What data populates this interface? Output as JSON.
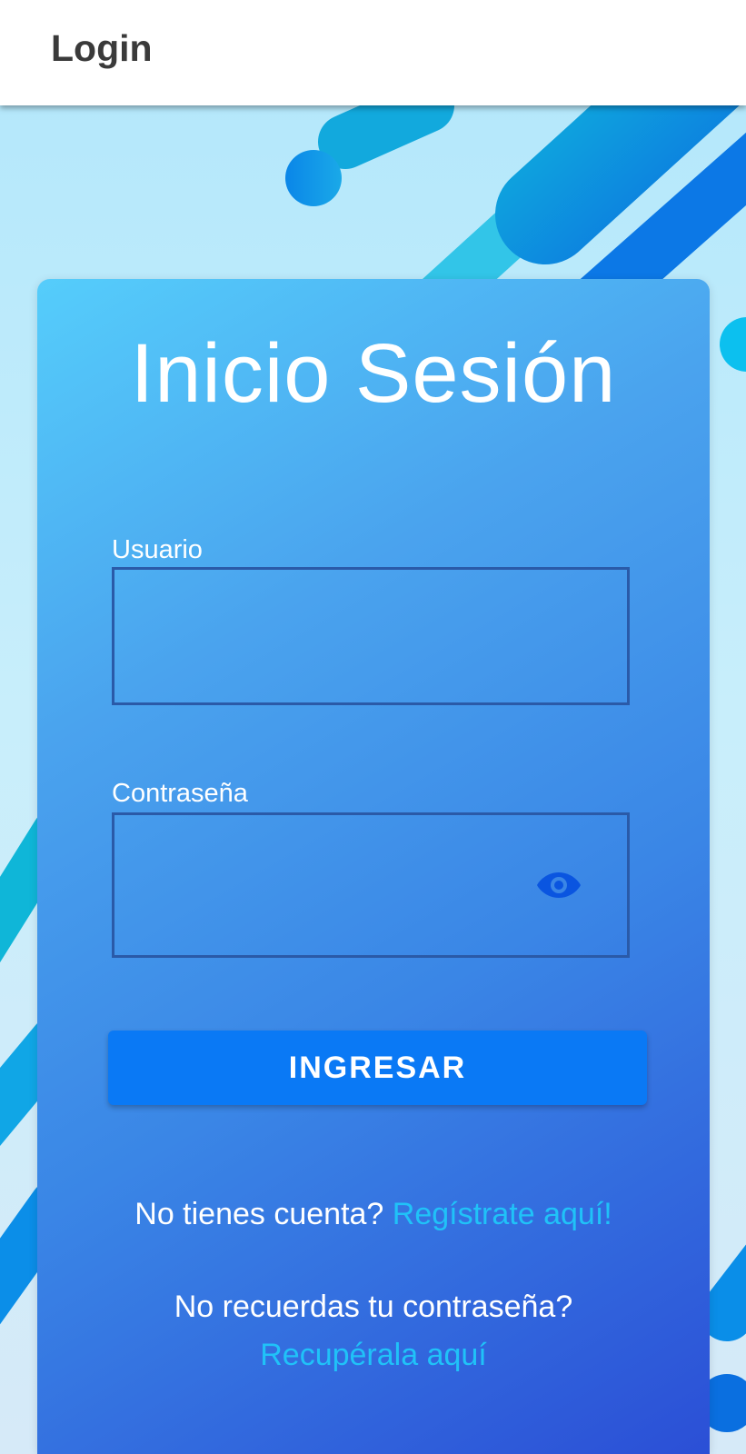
{
  "appbar": {
    "title": "Login"
  },
  "card": {
    "title": "Inicio Sesión",
    "username": {
      "label": "Usuario",
      "value": ""
    },
    "password": {
      "label": "Contraseña",
      "value": "",
      "toggle_icon": "eye-icon"
    },
    "submit_label": "INGRESAR",
    "register": {
      "text": "No tienes cuenta?",
      "link": "Regístrate aquí!"
    },
    "recover": {
      "text": "No recuerdas tu contraseña?",
      "link": "Recupérala aquí"
    }
  },
  "colors": {
    "card_gradient_start": "#55cdfb",
    "card_gradient_end": "#2b4fd6",
    "button": "#0a79f5",
    "link": "#20c2f8",
    "field_border": "#2a5aa8",
    "eye_icon": "#0a55e0"
  }
}
